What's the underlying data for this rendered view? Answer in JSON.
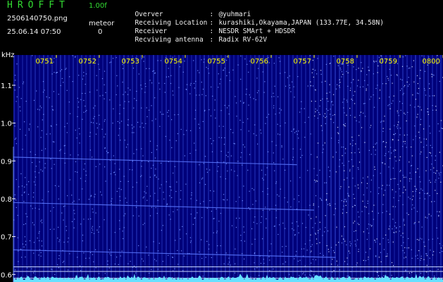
{
  "header": {
    "app_title": "HROFFT",
    "version": "1.00f",
    "filename": "2506140750.png",
    "datetime": "25.06.14 07:50",
    "mode_label": "meteor",
    "count": "0"
  },
  "station_info": [
    {
      "label": "Overver",
      "value": "@yuhmari"
    },
    {
      "label": "Receiving Location",
      "value": "kurashiki,Okayama,JAPAN (133.77E, 34.58N)"
    },
    {
      "label": "Receiver",
      "value": "NESDR SMArt + HDSDR"
    },
    {
      "label": "Recviving antenna",
      "value": "Radix RV-62V"
    }
  ],
  "separator": ":",
  "chart_data": {
    "type": "heatmap",
    "ylabel": "kHz",
    "y_ticks": [
      "1.1",
      "1.0",
      "0.9",
      "0.8",
      "0.7",
      "0.6"
    ],
    "y_tick_values": [
      1.1,
      1.0,
      0.9,
      0.8,
      0.7,
      0.6
    ],
    "x_ticks": [
      "0751",
      "0752",
      "0753",
      "0754",
      "0755",
      "0756",
      "0757",
      "0758",
      "0759",
      "0800"
    ],
    "x_tick_minutes": [
      1,
      2,
      3,
      4,
      5,
      6,
      7,
      8,
      9,
      10
    ],
    "xlim_minutes": [
      0,
      10
    ],
    "ylim_khz": [
      0.58,
      1.18
    ],
    "reference_lines_khz": [
      0.62,
      0.608,
      0.59
    ],
    "meteor_traces": [
      {
        "t": [
          0.0,
          6.6
        ],
        "khz": [
          0.91,
          0.89
        ]
      },
      {
        "t": [
          0.0,
          7.0
        ],
        "khz": [
          0.79,
          0.77
        ]
      },
      {
        "t": [
          0.0,
          7.5
        ],
        "khz": [
          0.665,
          0.645
        ]
      }
    ],
    "colors": {
      "background": "#00007a",
      "noise": "#4a6cff",
      "reference_line": "#c8d8ff",
      "baseline": "#66e0ff",
      "time_label": "#ffff00",
      "tick_label": "#ffffff"
    }
  }
}
